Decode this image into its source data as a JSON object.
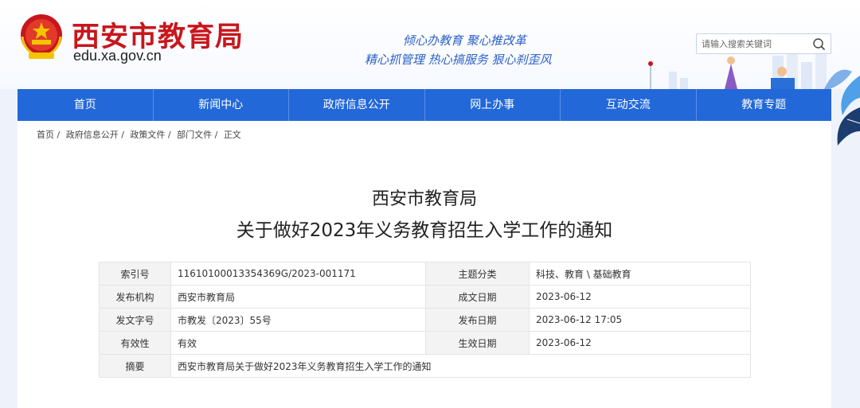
{
  "header": {
    "logo_text": "西安市教育局",
    "url": "edu.xa.gov.cn",
    "slogan_line1": "倾心办教育  聚心推改革",
    "slogan_line2": "精心抓管理  热心搞服务  狠心刹歪风",
    "search_placeholder": "请输入搜索关键词"
  },
  "nav": {
    "items": [
      {
        "label": "首页"
      },
      {
        "label": "新闻中心"
      },
      {
        "label": "政府信息公开"
      },
      {
        "label": "网上办事"
      },
      {
        "label": "互动交流"
      },
      {
        "label": "教育专题"
      }
    ]
  },
  "breadcrumb": {
    "items": [
      "首页 /",
      "政府信息公开 /",
      "政策文件 /",
      "部门文件 /",
      "正文"
    ]
  },
  "article": {
    "title_line1": "西安市教育局",
    "title_line2": "关于做好2023年义务教育招生入学工作的通知"
  },
  "meta": {
    "index_label": "索引号",
    "index_value": "11610100013354369G/2023-001171",
    "topic_label": "主题分类",
    "topic_value": "科技、教育 \\ 基础教育",
    "issuer_label": "发布机构",
    "issuer_value": "西安市教育局",
    "written_date_label": "成文日期",
    "written_date_value": "2023-06-12",
    "doc_no_label": "发文字号",
    "doc_no_value": "市教发〔2023〕55号",
    "publish_date_label": "发布日期",
    "publish_date_value": "2023-06-12 17:05",
    "validity_label": "有效性",
    "validity_value": "有效",
    "effective_date_label": "生效日期",
    "effective_date_value": "2023-06-12",
    "summary_label": "摘要",
    "summary_value": "西安市教育局关于做好2023年义务教育招生入学工作的通知"
  },
  "colors": {
    "nav_blue": "#2368d8",
    "logo_red": "#c8161d",
    "slogan_blue": "#2b5fc7"
  }
}
